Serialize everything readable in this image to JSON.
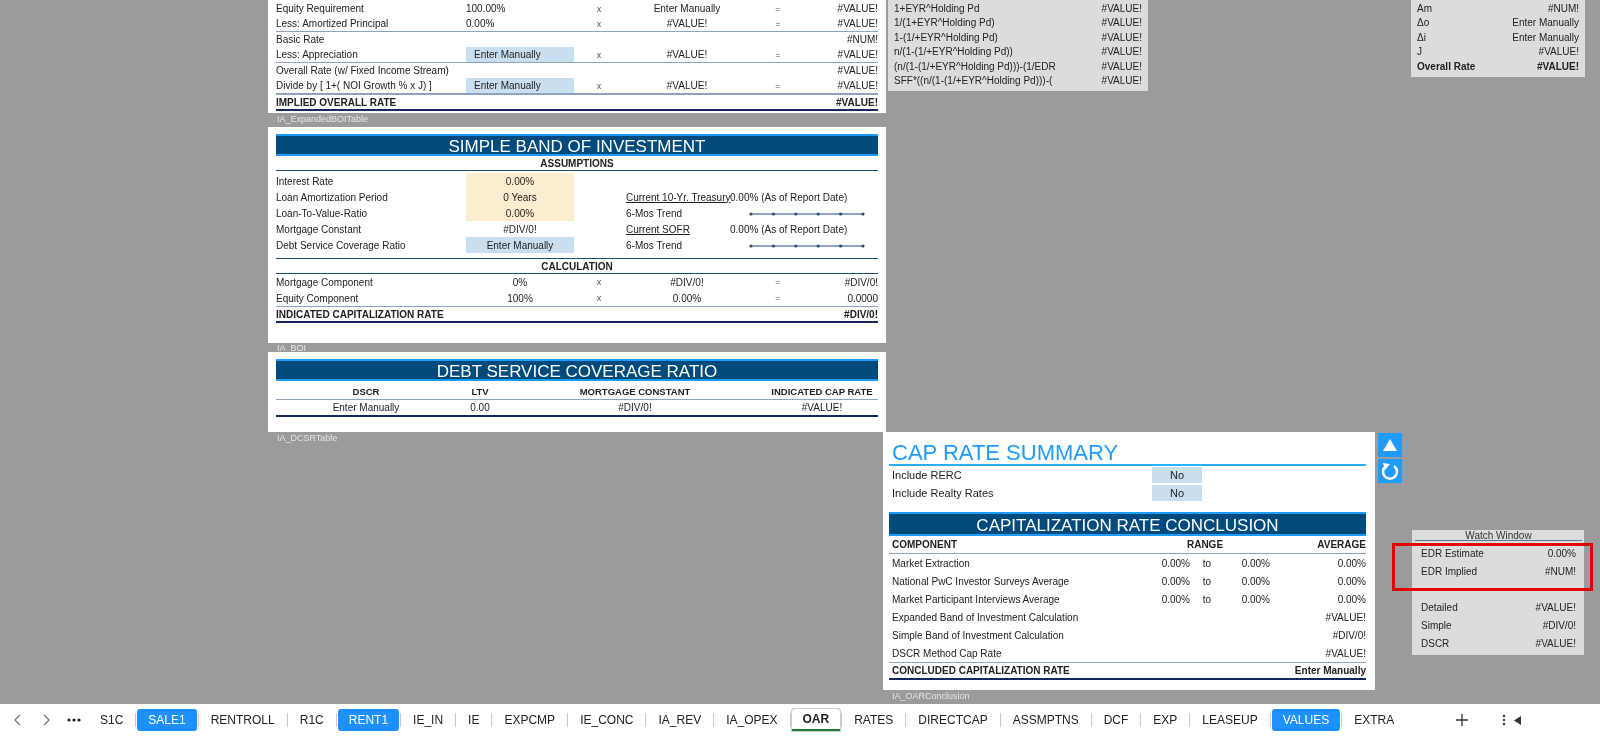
{
  "expanded_boi": {
    "groups": [
      {
        "rows": [
          {
            "label": "Equity Requirement",
            "value": "100.00%",
            "kind": "plain",
            "op": "x",
            "factor": "Enter Manually",
            "eq": "=",
            "result": "#VALUE!"
          },
          {
            "label": "Less: Amortized Principal",
            "value": "0.00%",
            "kind": "plain",
            "op": "x",
            "factor": "#VALUE!",
            "eq": "=",
            "result": "#VALUE!"
          }
        ]
      },
      {
        "rows": [
          {
            "label": "Basic Rate",
            "result": "#NUM!"
          },
          {
            "label": "Less: Appreciation",
            "value": "Enter Manually",
            "kind": "input",
            "op": "x",
            "factor": "#VALUE!",
            "eq": "=",
            "result": "#VALUE!"
          }
        ]
      },
      {
        "rows": [
          {
            "label": "Overall Rate (w/ Fixed Income Stream)",
            "result": "#VALUE!"
          },
          {
            "label": "Divide by [ 1+( NOI Growth % x J) ]",
            "value": "Enter Manually",
            "kind": "input",
            "op": "x",
            "factor": "#VALUE!",
            "eq": "=",
            "result": "#VALUE!"
          }
        ]
      }
    ],
    "total": {
      "label": "IMPLIED OVERALL RATE",
      "value": "#VALUE!"
    },
    "table_name": "IA_ExpandedBOITable"
  },
  "top_calc": {
    "rows": [
      {
        "label": "1+EYR^Holding Pd",
        "value": "#VALUE!"
      },
      {
        "label": "1/(1+EYR^Holding Pd)",
        "value": "#VALUE!"
      },
      {
        "label": "1-(1/+EYR^Holding Pd)",
        "value": "#VALUE!"
      },
      {
        "label": "n/(1-(1/+EYR^Holding Pd))",
        "value": "#VALUE!"
      },
      {
        "label": "(n/(1-(1/+EYR^Holding Pd)))-(1/EDR",
        "value": "#VALUE!"
      },
      {
        "label": "SFF*((n/(1-(1/+EYR^Holding Pd)))-(",
        "value": "#VALUE!"
      }
    ]
  },
  "top_right_calc": {
    "rows": [
      {
        "label": "Am",
        "value": "#NUM!",
        "bold": false
      },
      {
        "label": "Δo",
        "value": "Enter Manually",
        "bold": false
      },
      {
        "label": "Δi",
        "value": "Enter Manually",
        "bold": false
      },
      {
        "label": "J",
        "value": "#VALUE!",
        "bold": false
      },
      {
        "label": "Overall Rate",
        "value": "#VALUE!",
        "bold": true
      }
    ]
  },
  "simple_boi": {
    "title": "SIMPLE BAND OF INVESTMENT",
    "assumptions_heading": "ASSUMPTIONS",
    "assumptions": [
      {
        "label": "Interest Rate",
        "value": "0.00%",
        "kind": "assumption",
        "side": {
          "kind": "input_box"
        }
      },
      {
        "label": "Loan Amortization Period",
        "value": "0 Years",
        "kind": "assumption",
        "side": {
          "kind": "rate",
          "label": "Current 10-Yr. Treasury",
          "value": "0.00% (As of Report Date)"
        }
      },
      {
        "label": "Loan-To-Value-Ratio",
        "value": "0.00%",
        "kind": "assumption",
        "side": {
          "kind": "trend",
          "label": "6-Mos Trend"
        }
      },
      {
        "label": "Mortgage Constant",
        "value": "#DIV/0!",
        "kind": "plain",
        "side": {
          "kind": "rate",
          "label": "Current SOFR",
          "value": "0.00% (As of Report Date)"
        }
      },
      {
        "label": "Debt Service Coverage Ratio",
        "value": "Enter Manually",
        "kind": "input",
        "side": {
          "kind": "trend",
          "label": "6-Mos Trend"
        }
      }
    ],
    "calculation_heading": "CALCULATION",
    "calculation": [
      {
        "label": "Mortgage Component",
        "value": "0%",
        "kind": "plain",
        "op": "x",
        "factor": "#DIV/0!",
        "eq": "=",
        "result": "#DIV/0!"
      },
      {
        "label": "Equity Component",
        "value": "100%",
        "kind": "plain",
        "op": "x",
        "factor": "0.00%",
        "eq": "=",
        "result": "0.0000"
      }
    ],
    "total": {
      "label": "INDICATED CAPITALIZATION RATE",
      "value": "#DIV/0!"
    },
    "table_name": "IA_BOI"
  },
  "dscr": {
    "title": "DEBT SERVICE COVERAGE RATIO",
    "columns": [
      "DSCR",
      "LTV",
      "MORTGAGE CONSTANT",
      "INDICATED CAP RATE"
    ],
    "rows": [
      [
        "Enter Manually",
        "0.00",
        "#DIV/0!",
        "#VALUE!"
      ]
    ],
    "table_name": "IA_DCSRTable"
  },
  "cap_rate_summary": {
    "title": "CAP RATE SUMMARY",
    "toggles": [
      {
        "label": "Include RERC",
        "value": "No"
      },
      {
        "label": "Include Realty Rates",
        "value": "No"
      }
    ],
    "conclusion": {
      "title": "CAPITALIZATION RATE CONCLUSION",
      "columns": {
        "component": "COMPONENT",
        "range": "RANGE",
        "average": "AVERAGE"
      },
      "rows": [
        {
          "label": "Market Extraction",
          "low": "0.00%",
          "to": "to",
          "high": "0.00%",
          "average": "0.00%"
        },
        {
          "label": "National PwC Investor Surveys Average",
          "low": "0.00%",
          "to": "to",
          "high": "0.00%",
          "average": "0.00%"
        },
        {
          "label": "Market Participant Interviews Average",
          "low": "0.00%",
          "to": "to",
          "high": "0.00%",
          "average": "0.00%"
        },
        {
          "label": "Expanded Band of Investment Calculation",
          "average": "#VALUE!"
        },
        {
          "label": "Simple Band of Investment Calculation",
          "average": "#DIV/0!"
        },
        {
          "label": "DSCR Method Cap Rate",
          "average": "#VALUE!"
        }
      ],
      "total": {
        "label": "CONCLUDED CAPITALIZATION RATE",
        "value": "Enter Manually"
      }
    },
    "table_name": "IA_OARConclusion"
  },
  "watch_window": {
    "title": "Watch Window",
    "groups": [
      {
        "rows": [
          {
            "label": "EDR Estimate",
            "value": "0.00%"
          },
          {
            "label": "EDR Implied",
            "value": "#NUM!"
          }
        ]
      },
      {
        "rows": [
          {
            "label": "Detailed",
            "value": "#VALUE!"
          },
          {
            "label": "Simple",
            "value": "#DIV/0!"
          },
          {
            "label": "DSCR",
            "value": "#VALUE!"
          }
        ]
      }
    ]
  },
  "sheet_tabs": [
    {
      "label": "S1C",
      "selected": false,
      "highlighted": false
    },
    {
      "label": "SALE1",
      "selected": false,
      "highlighted": true
    },
    {
      "label": "RENTROLL",
      "selected": false,
      "highlighted": false
    },
    {
      "label": "R1C",
      "selected": false,
      "highlighted": false
    },
    {
      "label": "RENT1",
      "selected": false,
      "highlighted": true
    },
    {
      "label": "IE_IN",
      "selected": false,
      "highlighted": false
    },
    {
      "label": "IE",
      "selected": false,
      "highlighted": false
    },
    {
      "label": "EXPCMP",
      "selected": false,
      "highlighted": false
    },
    {
      "label": "IE_CONC",
      "selected": false,
      "highlighted": false
    },
    {
      "label": "IA_REV",
      "selected": false,
      "highlighted": false
    },
    {
      "label": "IA_OPEX",
      "selected": false,
      "highlighted": false
    },
    {
      "label": "OAR",
      "selected": true,
      "highlighted": false
    },
    {
      "label": "RATES",
      "selected": false,
      "highlighted": false
    },
    {
      "label": "DIRECTCAP",
      "selected": false,
      "highlighted": false
    },
    {
      "label": "ASSMPTNS",
      "selected": false,
      "highlighted": false
    },
    {
      "label": "DCF",
      "selected": false,
      "highlighted": false
    },
    {
      "label": "EXP",
      "selected": false,
      "highlighted": false
    },
    {
      "label": "LEASEUP",
      "selected": false,
      "highlighted": false
    },
    {
      "label": "VALUES",
      "selected": false,
      "highlighted": true
    },
    {
      "label": "EXTRA",
      "selected": false,
      "highlighted": false
    }
  ]
}
